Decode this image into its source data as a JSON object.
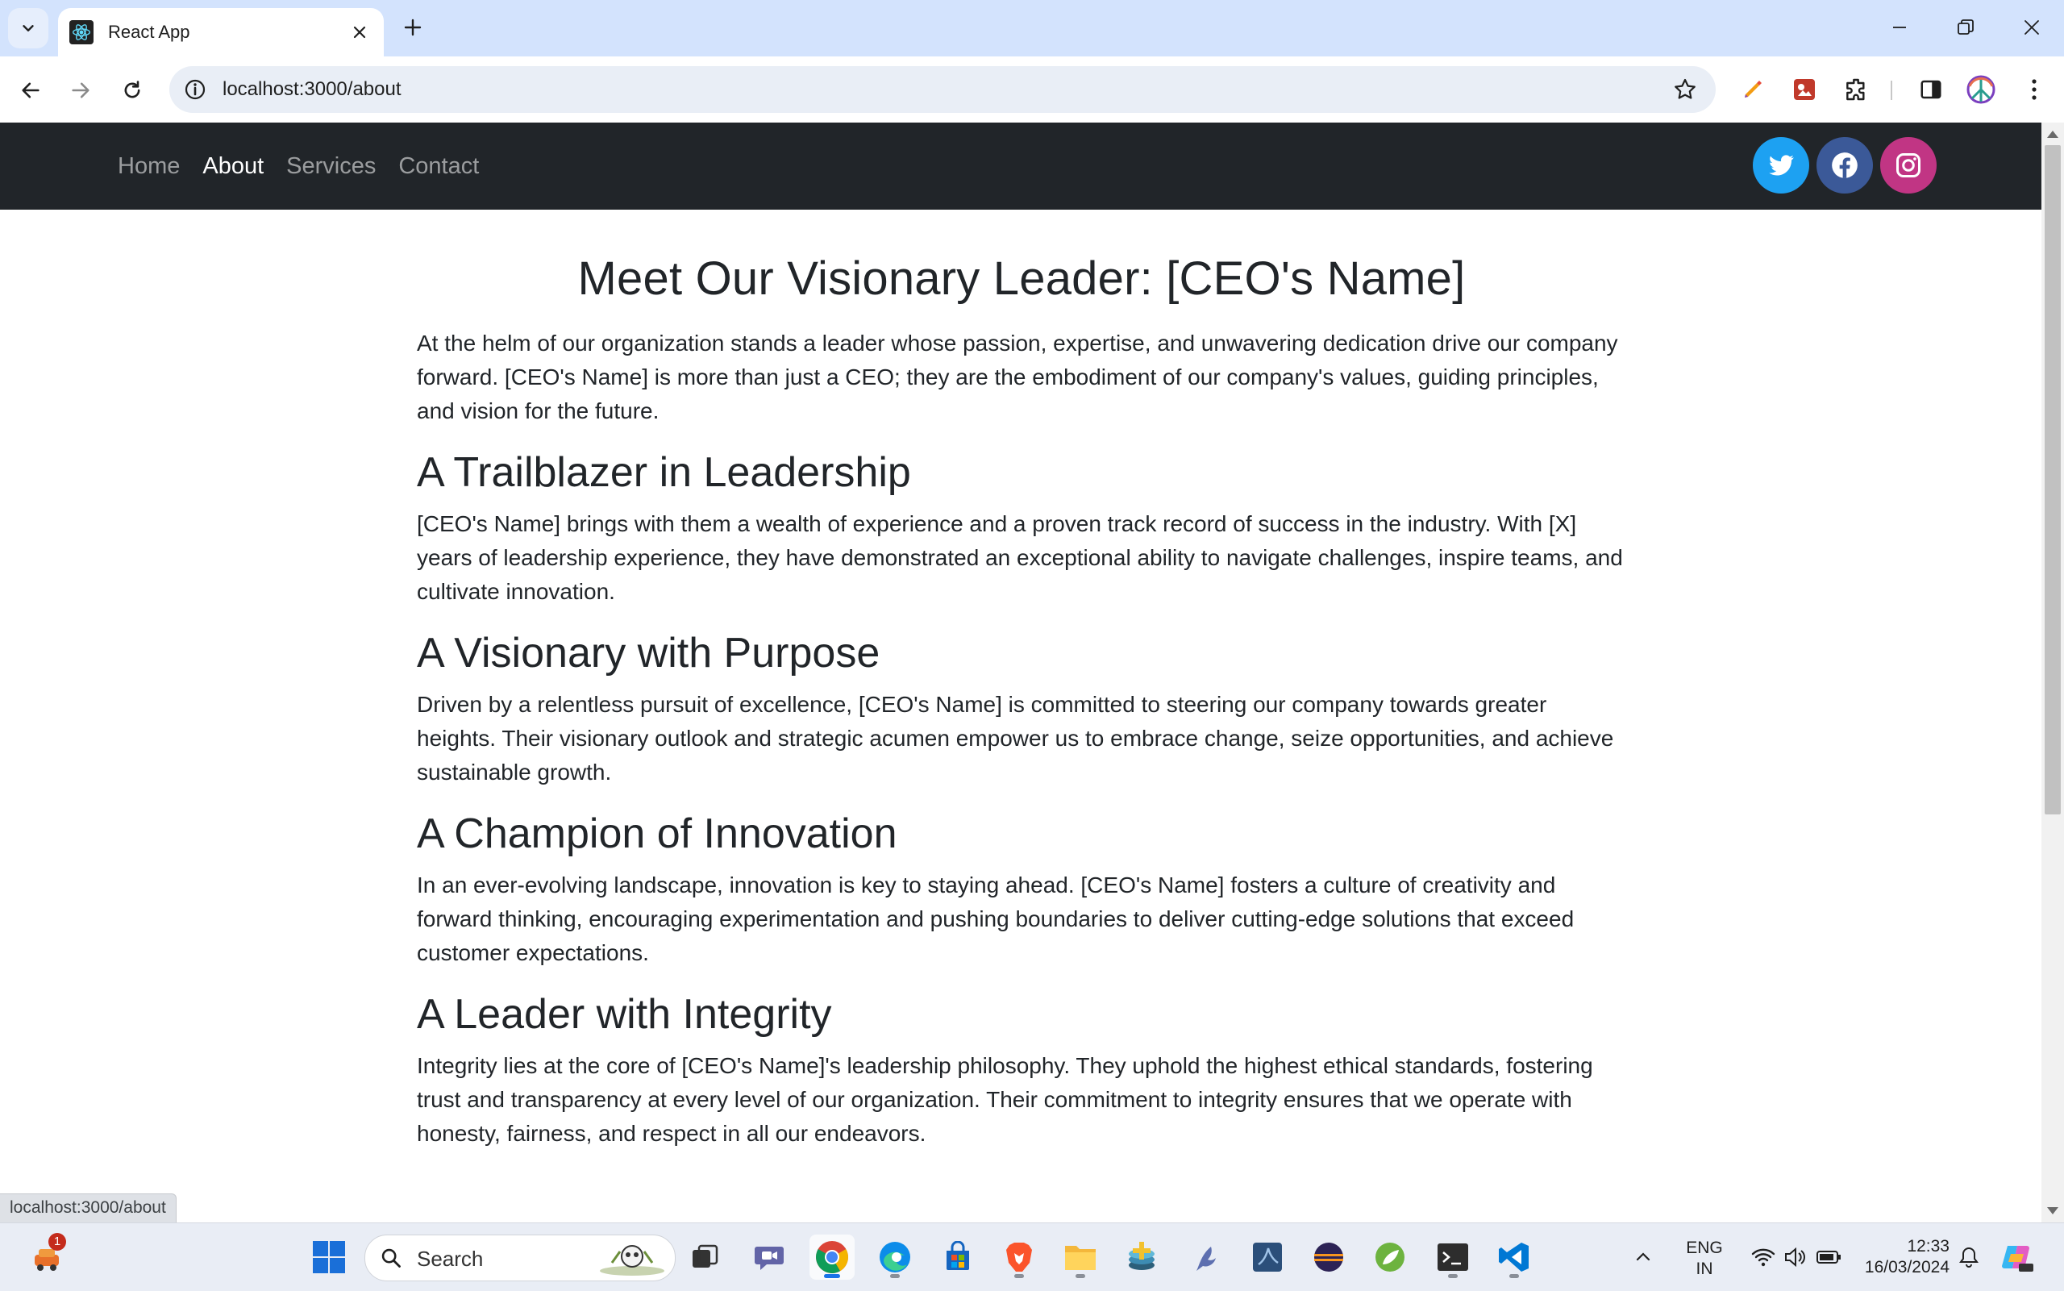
{
  "browser": {
    "tab_title": "React App",
    "url": "localhost:3000/about",
    "status_url": "localhost:3000/about"
  },
  "navbar": {
    "links": [
      {
        "label": "Home",
        "active": false
      },
      {
        "label": "About",
        "active": true
      },
      {
        "label": "Services",
        "active": false
      },
      {
        "label": "Contact",
        "active": false
      }
    ],
    "social": [
      {
        "icon": "twitter-icon",
        "color": "#1da1f2"
      },
      {
        "icon": "facebook-icon",
        "color": "#3b5998"
      },
      {
        "icon": "instagram-icon",
        "color": "#c13584"
      }
    ]
  },
  "content": {
    "title": "Meet Our Visionary Leader: [CEO's Name]",
    "intro": "At the helm of our organization stands a leader whose passion, expertise, and unwavering dedication drive our company forward. [CEO's Name] is more than just a CEO; they are the embodiment of our company's values, guiding principles, and vision for the future.",
    "sections": [
      {
        "heading": "A Trailblazer in Leadership",
        "text": "[CEO's Name] brings with them a wealth of experience and a proven track record of success in the industry. With [X] years of leadership experience, they have demonstrated an exceptional ability to navigate challenges, inspire teams, and cultivate innovation."
      },
      {
        "heading": "A Visionary with Purpose",
        "text": "Driven by a relentless pursuit of excellence, [CEO's Name] is committed to steering our company towards greater heights. Their visionary outlook and strategic acumen empower us to embrace change, seize opportunities, and achieve sustainable growth."
      },
      {
        "heading": "A Champion of Innovation",
        "text": "In an ever-evolving landscape, innovation is key to staying ahead. [CEO's Name] fosters a culture of creativity and forward thinking, encouraging experimentation and pushing boundaries to deliver cutting-edge solutions that exceed customer expectations."
      },
      {
        "heading": "A Leader with Integrity",
        "text": "Integrity lies at the core of [CEO's Name]'s leadership philosophy. They uphold the highest ethical standards, fostering trust and transparency at every level of our organization. Their commitment to integrity ensures that we operate with honesty, fairness, and respect in all our endeavors."
      }
    ]
  },
  "taskbar": {
    "search_label": "Search",
    "notification_count": "1",
    "language_line1": "ENG",
    "language_line2": "IN",
    "time": "12:33",
    "date": "16/03/2024"
  }
}
